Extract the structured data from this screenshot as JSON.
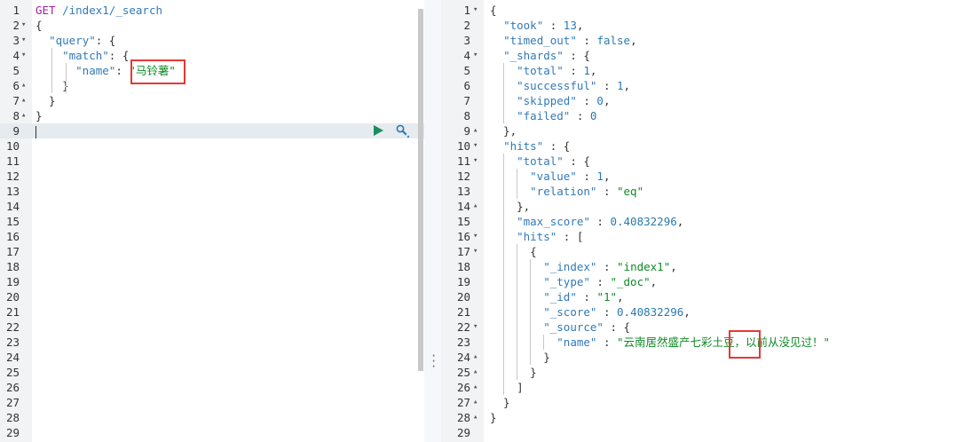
{
  "request_editor": {
    "lines": [
      {
        "n": "1",
        "fold": "",
        "parts": [
          {
            "c": "m",
            "t": "GET"
          },
          {
            "c": "p",
            "t": " "
          },
          {
            "c": "k",
            "t": "/index1/_search"
          }
        ]
      },
      {
        "n": "2",
        "fold": "▾",
        "parts": [
          {
            "c": "p",
            "t": "{"
          }
        ]
      },
      {
        "n": "3",
        "fold": "▾",
        "parts": [
          {
            "c": "p",
            "t": "  "
          },
          {
            "c": "k",
            "t": "\"query\""
          },
          {
            "c": "p",
            "t": ": {"
          }
        ]
      },
      {
        "n": "4",
        "fold": "▾",
        "parts": [
          {
            "c": "p",
            "t": "    "
          },
          {
            "c": "k",
            "t": "\"match\""
          },
          {
            "c": "p",
            "t": ": {"
          }
        ]
      },
      {
        "n": "5",
        "fold": "",
        "parts": [
          {
            "c": "p",
            "t": "      "
          },
          {
            "c": "k",
            "t": "\"name\""
          },
          {
            "c": "p",
            "t": ": "
          },
          {
            "c": "s",
            "t": "\"马铃薯\""
          }
        ]
      },
      {
        "n": "6",
        "fold": "▴",
        "parts": [
          {
            "c": "p",
            "t": "    }"
          }
        ]
      },
      {
        "n": "7",
        "fold": "▴",
        "parts": [
          {
            "c": "p",
            "t": "  }"
          }
        ]
      },
      {
        "n": "8",
        "fold": "▴",
        "parts": [
          {
            "c": "p",
            "t": "}"
          }
        ]
      },
      {
        "n": "9",
        "fold": "",
        "parts": []
      },
      {
        "n": "10",
        "fold": "",
        "parts": []
      },
      {
        "n": "11",
        "fold": "",
        "parts": []
      },
      {
        "n": "12",
        "fold": "",
        "parts": []
      },
      {
        "n": "13",
        "fold": "",
        "parts": []
      },
      {
        "n": "14",
        "fold": "",
        "parts": []
      },
      {
        "n": "15",
        "fold": "",
        "parts": []
      },
      {
        "n": "16",
        "fold": "",
        "parts": []
      },
      {
        "n": "17",
        "fold": "",
        "parts": []
      },
      {
        "n": "18",
        "fold": "",
        "parts": []
      },
      {
        "n": "19",
        "fold": "",
        "parts": []
      },
      {
        "n": "20",
        "fold": "",
        "parts": []
      },
      {
        "n": "21",
        "fold": "",
        "parts": []
      },
      {
        "n": "22",
        "fold": "",
        "parts": []
      },
      {
        "n": "23",
        "fold": "",
        "parts": []
      },
      {
        "n": "24",
        "fold": "",
        "parts": []
      },
      {
        "n": "25",
        "fold": "",
        "parts": []
      },
      {
        "n": "26",
        "fold": "",
        "parts": []
      },
      {
        "n": "27",
        "fold": "",
        "parts": []
      },
      {
        "n": "28",
        "fold": "",
        "parts": []
      },
      {
        "n": "29",
        "fold": "",
        "parts": []
      }
    ],
    "active_line": "9"
  },
  "response_viewer": {
    "lines": [
      {
        "n": "1",
        "fold": "▾",
        "parts": [
          {
            "c": "p",
            "t": "{"
          }
        ]
      },
      {
        "n": "2",
        "fold": "",
        "parts": [
          {
            "c": "p",
            "t": "  "
          },
          {
            "c": "k",
            "t": "\"took\""
          },
          {
            "c": "p",
            "t": " : "
          },
          {
            "c": "n",
            "t": "13"
          },
          {
            "c": "p",
            "t": ","
          }
        ]
      },
      {
        "n": "3",
        "fold": "",
        "parts": [
          {
            "c": "p",
            "t": "  "
          },
          {
            "c": "k",
            "t": "\"timed_out\""
          },
          {
            "c": "p",
            "t": " : "
          },
          {
            "c": "b",
            "t": "false"
          },
          {
            "c": "p",
            "t": ","
          }
        ]
      },
      {
        "n": "4",
        "fold": "▾",
        "parts": [
          {
            "c": "p",
            "t": "  "
          },
          {
            "c": "k",
            "t": "\"_shards\""
          },
          {
            "c": "p",
            "t": " : {"
          }
        ]
      },
      {
        "n": "5",
        "fold": "",
        "parts": [
          {
            "c": "p",
            "t": "    "
          },
          {
            "c": "k",
            "t": "\"total\""
          },
          {
            "c": "p",
            "t": " : "
          },
          {
            "c": "n",
            "t": "1"
          },
          {
            "c": "p",
            "t": ","
          }
        ]
      },
      {
        "n": "6",
        "fold": "",
        "parts": [
          {
            "c": "p",
            "t": "    "
          },
          {
            "c": "k",
            "t": "\"successful\""
          },
          {
            "c": "p",
            "t": " : "
          },
          {
            "c": "n",
            "t": "1"
          },
          {
            "c": "p",
            "t": ","
          }
        ]
      },
      {
        "n": "7",
        "fold": "",
        "parts": [
          {
            "c": "p",
            "t": "    "
          },
          {
            "c": "k",
            "t": "\"skipped\""
          },
          {
            "c": "p",
            "t": " : "
          },
          {
            "c": "n",
            "t": "0"
          },
          {
            "c": "p",
            "t": ","
          }
        ]
      },
      {
        "n": "8",
        "fold": "",
        "parts": [
          {
            "c": "p",
            "t": "    "
          },
          {
            "c": "k",
            "t": "\"failed\""
          },
          {
            "c": "p",
            "t": " : "
          },
          {
            "c": "n",
            "t": "0"
          }
        ]
      },
      {
        "n": "9",
        "fold": "▴",
        "parts": [
          {
            "c": "p",
            "t": "  },"
          }
        ]
      },
      {
        "n": "10",
        "fold": "▾",
        "parts": [
          {
            "c": "p",
            "t": "  "
          },
          {
            "c": "k",
            "t": "\"hits\""
          },
          {
            "c": "p",
            "t": " : {"
          }
        ]
      },
      {
        "n": "11",
        "fold": "▾",
        "parts": [
          {
            "c": "p",
            "t": "    "
          },
          {
            "c": "k",
            "t": "\"total\""
          },
          {
            "c": "p",
            "t": " : {"
          }
        ]
      },
      {
        "n": "12",
        "fold": "",
        "parts": [
          {
            "c": "p",
            "t": "      "
          },
          {
            "c": "k",
            "t": "\"value\""
          },
          {
            "c": "p",
            "t": " : "
          },
          {
            "c": "n",
            "t": "1"
          },
          {
            "c": "p",
            "t": ","
          }
        ]
      },
      {
        "n": "13",
        "fold": "",
        "parts": [
          {
            "c": "p",
            "t": "      "
          },
          {
            "c": "k",
            "t": "\"relation\""
          },
          {
            "c": "p",
            "t": " : "
          },
          {
            "c": "s",
            "t": "\"eq\""
          }
        ]
      },
      {
        "n": "14",
        "fold": "▴",
        "parts": [
          {
            "c": "p",
            "t": "    },"
          }
        ]
      },
      {
        "n": "15",
        "fold": "",
        "parts": [
          {
            "c": "p",
            "t": "    "
          },
          {
            "c": "k",
            "t": "\"max_score\""
          },
          {
            "c": "p",
            "t": " : "
          },
          {
            "c": "n",
            "t": "0.40832296"
          },
          {
            "c": "p",
            "t": ","
          }
        ]
      },
      {
        "n": "16",
        "fold": "▾",
        "parts": [
          {
            "c": "p",
            "t": "    "
          },
          {
            "c": "k",
            "t": "\"hits\""
          },
          {
            "c": "p",
            "t": " : ["
          }
        ]
      },
      {
        "n": "17",
        "fold": "▾",
        "parts": [
          {
            "c": "p",
            "t": "      {"
          }
        ]
      },
      {
        "n": "18",
        "fold": "",
        "parts": [
          {
            "c": "p",
            "t": "        "
          },
          {
            "c": "k",
            "t": "\"_index\""
          },
          {
            "c": "p",
            "t": " : "
          },
          {
            "c": "s",
            "t": "\"index1\""
          },
          {
            "c": "p",
            "t": ","
          }
        ]
      },
      {
        "n": "19",
        "fold": "",
        "parts": [
          {
            "c": "p",
            "t": "        "
          },
          {
            "c": "k",
            "t": "\"_type\""
          },
          {
            "c": "p",
            "t": " : "
          },
          {
            "c": "s",
            "t": "\"_doc\""
          },
          {
            "c": "p",
            "t": ","
          }
        ]
      },
      {
        "n": "20",
        "fold": "",
        "parts": [
          {
            "c": "p",
            "t": "        "
          },
          {
            "c": "k",
            "t": "\"_id\""
          },
          {
            "c": "p",
            "t": " : "
          },
          {
            "c": "s",
            "t": "\"1\""
          },
          {
            "c": "p",
            "t": ","
          }
        ]
      },
      {
        "n": "21",
        "fold": "",
        "parts": [
          {
            "c": "p",
            "t": "        "
          },
          {
            "c": "k",
            "t": "\"_score\""
          },
          {
            "c": "p",
            "t": " : "
          },
          {
            "c": "n",
            "t": "0.40832296"
          },
          {
            "c": "p",
            "t": ","
          }
        ]
      },
      {
        "n": "22",
        "fold": "▾",
        "parts": [
          {
            "c": "p",
            "t": "        "
          },
          {
            "c": "k",
            "t": "\"_source\""
          },
          {
            "c": "p",
            "t": " : {"
          }
        ]
      },
      {
        "n": "23",
        "fold": "",
        "parts": [
          {
            "c": "p",
            "t": "          "
          },
          {
            "c": "k",
            "t": "\"name\""
          },
          {
            "c": "p",
            "t": " : "
          },
          {
            "c": "s",
            "t": "\"云南居然盛产七彩土豆，以前从没见过！\""
          }
        ]
      },
      {
        "n": "24",
        "fold": "▴",
        "parts": [
          {
            "c": "p",
            "t": "        }"
          }
        ]
      },
      {
        "n": "25",
        "fold": "▴",
        "parts": [
          {
            "c": "p",
            "t": "      }"
          }
        ]
      },
      {
        "n": "26",
        "fold": "▴",
        "parts": [
          {
            "c": "p",
            "t": "    ]"
          }
        ]
      },
      {
        "n": "27",
        "fold": "▴",
        "parts": [
          {
            "c": "p",
            "t": "  }"
          }
        ]
      },
      {
        "n": "28",
        "fold": "▴",
        "parts": [
          {
            "c": "p",
            "t": "}"
          }
        ]
      },
      {
        "n": "29",
        "fold": "",
        "parts": []
      }
    ]
  },
  "toolbar": {
    "run_icon": "play-icon",
    "settings_icon": "wrench-icon"
  },
  "colors": {
    "key": "#337ab7",
    "string": "#108a26",
    "method": "#a41ea4",
    "number": "#2a7ab0",
    "highlight_box": "#e53935",
    "run": "#1c8d5b"
  }
}
